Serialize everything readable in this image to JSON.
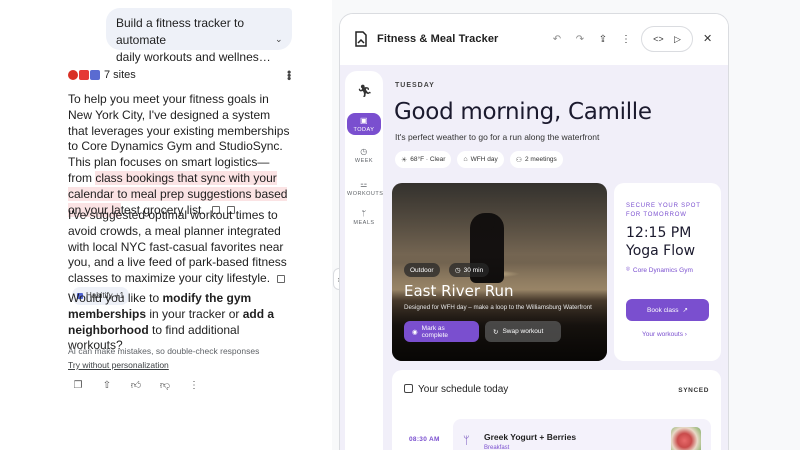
{
  "chat": {
    "user_prompt_line1": "Build a fitness tracker to automate",
    "user_prompt_line2": "daily workouts and wellness routines",
    "sites_label": "7 sites",
    "para1_a": "To help you meet your fitness goals in New York City, I've designed a system that leverages your existing memberships to Core Dynamics Gym and StudioSync. This plan focuses on smart logistics—from ",
    "para1_hl": "class bookings that sync with your calendar to meal prep suggestions based on your la",
    "para1_b": "test grocery list.",
    "para2": "I've suggested optimal workout times to avoid crowds, a meal planner integrated with local NYC fast-casual favorites near you, and a live feed of park-based fitness classes to maximize your city lifestyle.",
    "para2_chip": "Habitify +1",
    "para3_a": "Would you like to ",
    "para3_b1": "modify the gym memberships",
    "para3_c": " in your tracker or ",
    "para3_b2": "add a neighborhood",
    "para3_d": " to find additional workouts?",
    "disclaimer": "AI can make mistakes, so double-check responses",
    "try_link": "Try without personalization"
  },
  "app": {
    "title": "Fitness & Meal Tracker",
    "rail": [
      {
        "label": "TODAY",
        "icon": "calendar-icon"
      },
      {
        "label": "WEEK",
        "icon": "clock-icon"
      },
      {
        "label": "WORKOUTS",
        "icon": "dumbbell-icon"
      },
      {
        "label": "MEALS",
        "icon": "fork-icon"
      }
    ],
    "day": "TUESDAY",
    "greeting": "Good morning, Camille",
    "subgreeting": "It's perfect weather to go for a run along the waterfront",
    "chips": [
      "68°F · Clear",
      "WFH day",
      "2 meetings"
    ],
    "hero": {
      "tag1": "Outdoor",
      "tag2": "30 min",
      "title": "East River Run",
      "subtitle": "Designed for WFH day – make a loop to the Williamsburg Waterfront",
      "primary_btn": "Mark as complete",
      "secondary_btn": "Swap workout"
    },
    "side": {
      "label_line1": "SECURE YOUR SPOT",
      "label_line2": "FOR TOMORROW",
      "time": "12:15 PM",
      "class_name": "Yoga Flow",
      "location": "Core Dynamics Gym",
      "book_btn": "Book class",
      "link": "Your workouts"
    },
    "schedule": {
      "title": "Your schedule today",
      "status": "SYNCED",
      "time": "08:30 AM",
      "meal_name": "Greek Yogurt + Berries",
      "meal_type": "Breakfast"
    }
  },
  "colors": {
    "accent": "#7a4fcf",
    "app_bg": "#f1eff9",
    "highlight": "#fbe3e4"
  }
}
